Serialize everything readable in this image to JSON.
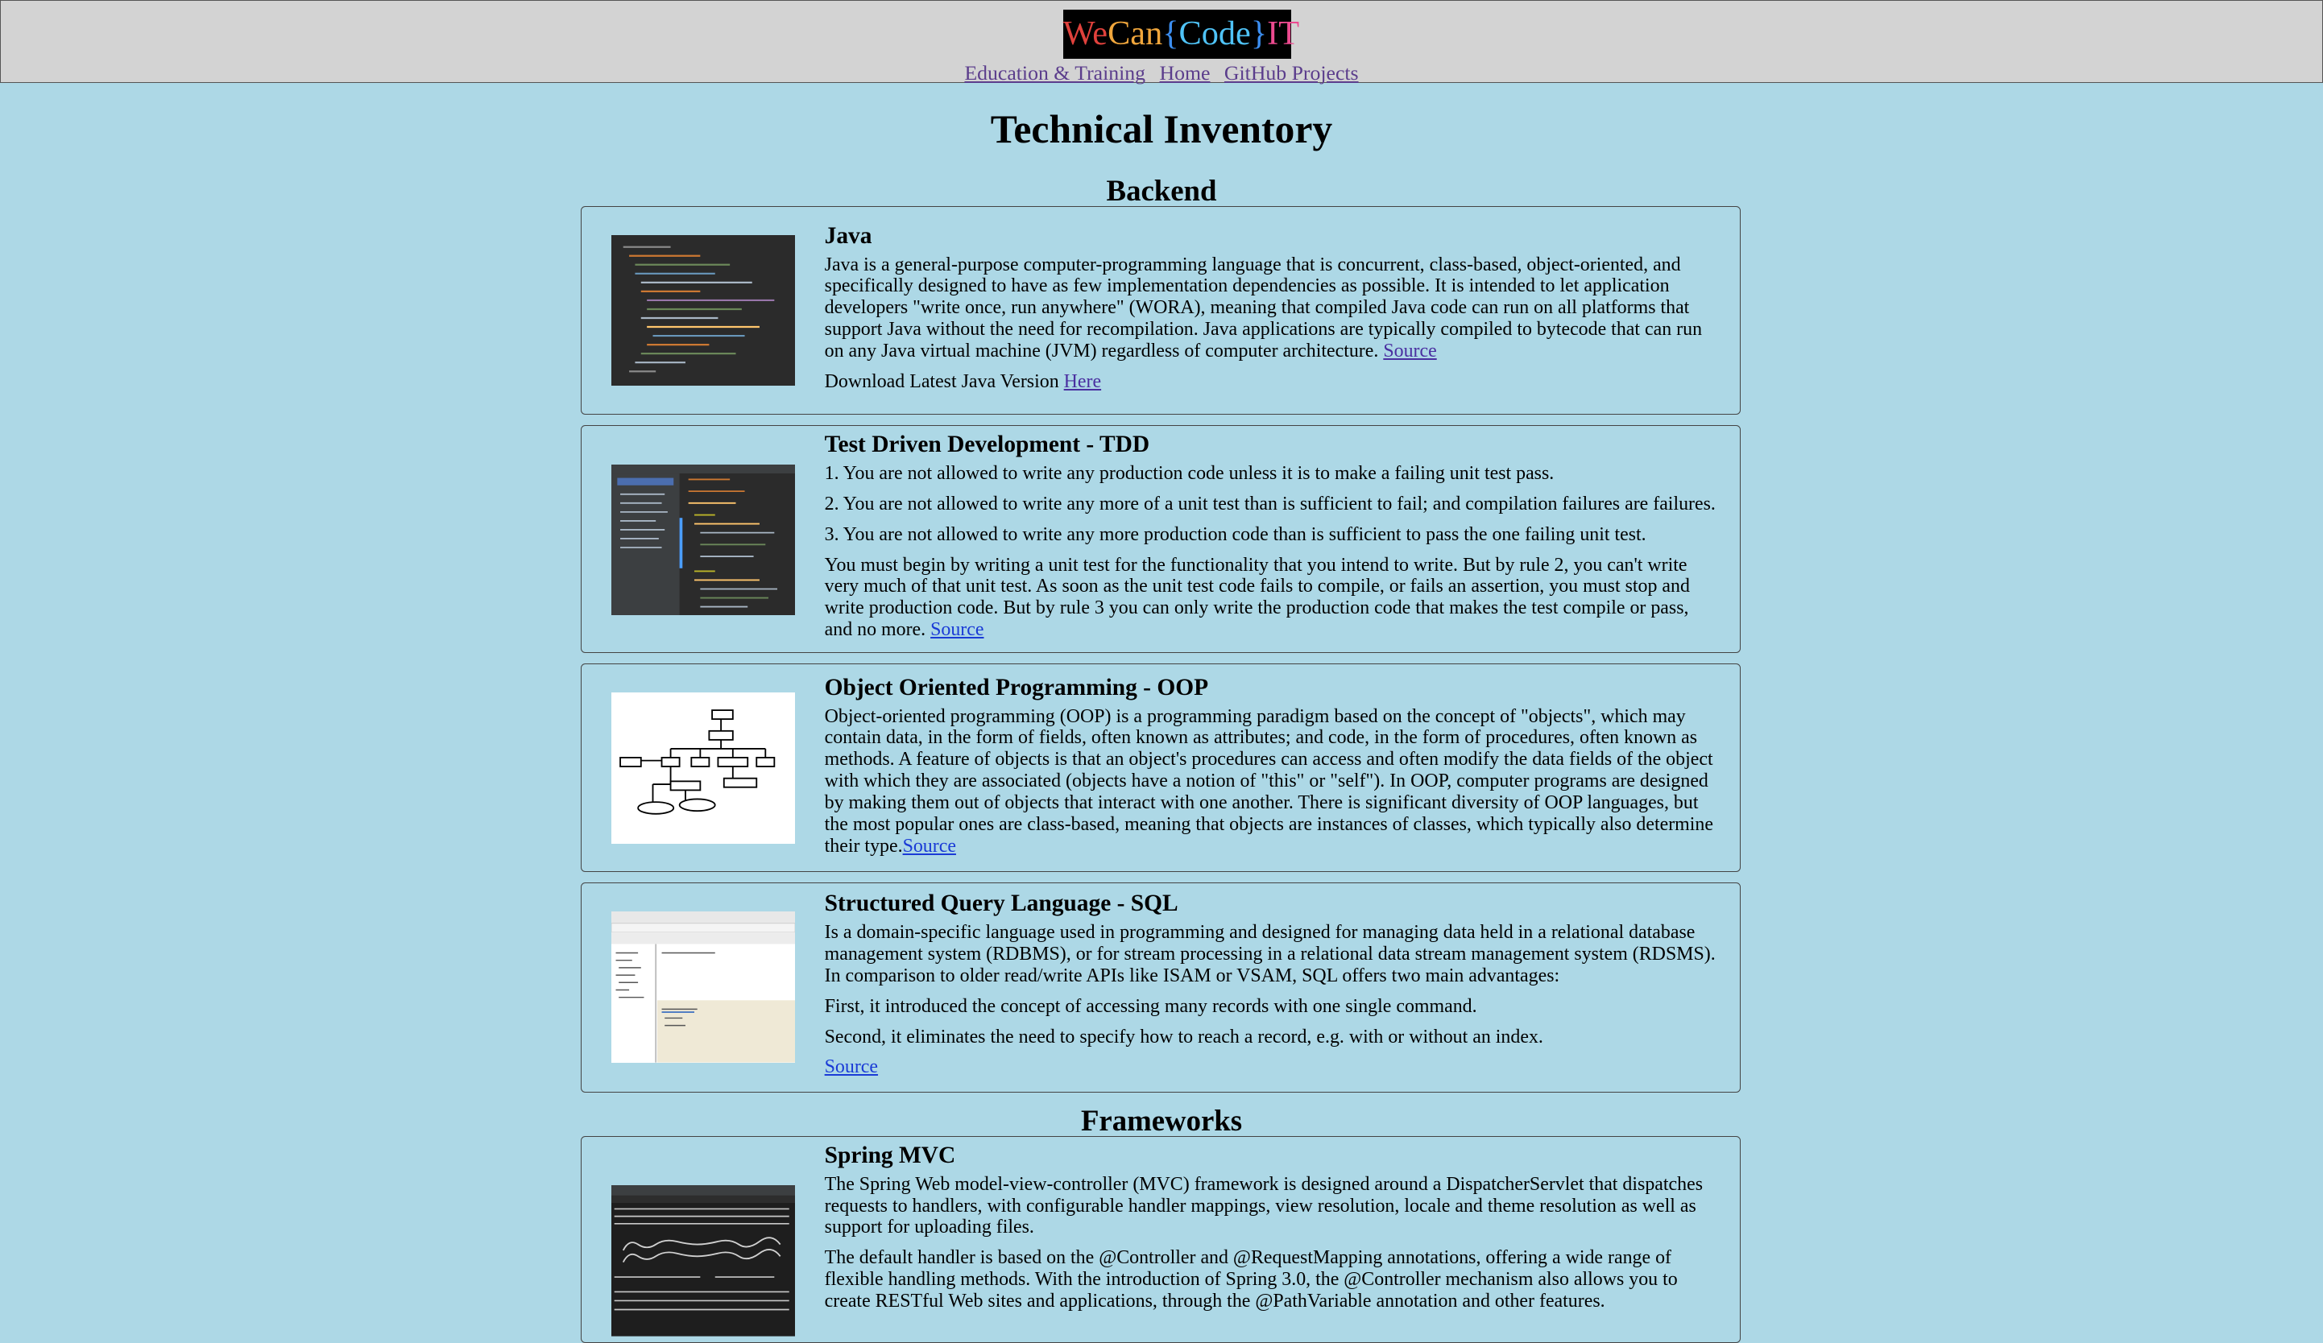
{
  "header": {
    "logo": {
      "we": "We",
      "can": "Can",
      "open": "{",
      "code": "Code",
      "close": "}",
      "it": "IT"
    },
    "nav": [
      {
        "label": "Education & Training"
      },
      {
        "label": "Home"
      },
      {
        "label": "GitHub Projects"
      }
    ]
  },
  "page_title": "Technical Inventory",
  "sections": {
    "backend": "Backend",
    "frameworks": "Frameworks"
  },
  "java": {
    "title": "Java",
    "body": "Java is a general-purpose computer-programming language that is concurrent, class-based, object-oriented, and specifically designed to have as few implementation dependencies as possible. It is intended to let application developers \"write once, run anywhere\" (WORA), meaning that compiled Java code can run on all platforms that support Java without the need for recompilation. Java applications are typically compiled to bytecode that can run on any Java virtual machine (JVM) regardless of computer architecture.",
    "source_link": "Source",
    "download_text": "Download Latest Java Version",
    "download_link": "Here"
  },
  "tdd": {
    "title": "Test Driven Development - TDD",
    "rule1": "1. You are not allowed to write any production code unless it is to make a failing unit test pass.",
    "rule2": "2. You are not allowed to write any more of a unit test than is sufficient to fail; and compilation failures are failures.",
    "rule3": "3. You are not allowed to write any more production code than is sufficient to pass the one failing unit test.",
    "body": "You must begin by writing a unit test for the functionality that you intend to write. But by rule 2, you can't write very much of that unit test. As soon as the unit test code fails to compile, or fails an assertion, you must stop and write production code. But by rule 3 you can only write the production code that makes the test compile or pass, and no more.",
    "source_link": "Source"
  },
  "oop": {
    "title": "Object Oriented Programming - OOP",
    "body": "Object-oriented programming (OOP) is a programming paradigm based on the concept of \"objects\", which may contain data, in the form of fields, often known as attributes; and code, in the form of procedures, often known as methods. A feature of objects is that an object's procedures can access and often modify the data fields of the object with which they are associated (objects have a notion of \"this\" or \"self\"). In OOP, computer programs are designed by making them out of objects that interact with one another. There is significant diversity of OOP languages, but the most popular ones are class-based, meaning that objects are instances of classes, which typically also determine their type.",
    "source_link": "Source"
  },
  "sql": {
    "title": "Structured Query Language - SQL",
    "body": "Is a domain-specific language used in programming and designed for managing data held in a relational database management system (RDBMS), or for stream processing in a relational data stream management system (RDSMS). In comparison to older read/write APIs like ISAM or VSAM, SQL offers two main advantages:",
    "first": "First, it introduced the concept of accessing many records with one single command.",
    "second": "Second, it eliminates the need to specify how to reach a record, e.g. with or without an index.",
    "source_link": "Source"
  },
  "spring": {
    "title": "Spring MVC",
    "body1": "The Spring Web model-view-controller (MVC) framework is designed around a DispatcherServlet that dispatches requests to handlers, with configurable handler mappings, view resolution, locale and theme resolution as well as support for uploading files.",
    "body2": "The default handler is based on the @Controller and @RequestMapping annotations, offering a wide range of flexible handling methods. With the introduction of Spring 3.0, the @Controller mechanism also allows you to create RESTful Web sites and applications, through the @PathVariable annotation and other features."
  },
  "colors": {
    "page_bg": "#add8e6",
    "header_bg": "#d3d3d3",
    "link_visited": "#5b3d8c",
    "link": "#1a3bd6"
  }
}
